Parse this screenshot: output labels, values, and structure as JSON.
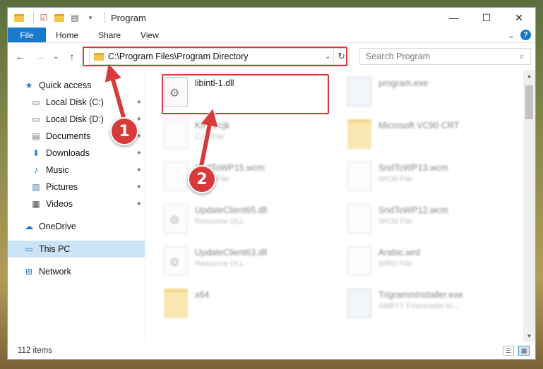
{
  "window": {
    "title": "Program",
    "controls": {
      "minimize": "—",
      "maximize": "☐",
      "close": "✕"
    }
  },
  "ribbon": {
    "tabs": [
      "File",
      "Home",
      "Share",
      "View"
    ],
    "expand": "⌄",
    "help": "?"
  },
  "nav": {
    "back": "←",
    "forward": "→",
    "recent": "⌄",
    "up": "↑"
  },
  "address": {
    "path": "C:\\Program Files\\Program Directory",
    "dropdown": "⌄",
    "refresh": "↻"
  },
  "search": {
    "placeholder": "Search Program",
    "icon": "⌕"
  },
  "sidebar": {
    "items": [
      {
        "label": "Quick access",
        "icon": "star-icon",
        "glyph": "★",
        "color": "#1979ca"
      },
      {
        "label": "Local Disk (C:)",
        "icon": "drive-icon",
        "glyph": "▭",
        "pinned": true
      },
      {
        "label": "Local Disk (D:)",
        "icon": "drive-icon",
        "glyph": "▭",
        "pinned": true
      },
      {
        "label": "Documents",
        "icon": "documents-icon",
        "glyph": "▤",
        "pinned": true
      },
      {
        "label": "Downloads",
        "icon": "downloads-icon",
        "glyph": "⬇",
        "pinned": true,
        "color": "#1979ca"
      },
      {
        "label": "Music",
        "icon": "music-icon",
        "glyph": "♪",
        "pinned": true,
        "color": "#1979ca"
      },
      {
        "label": "Pictures",
        "icon": "pictures-icon",
        "glyph": "▨",
        "pinned": true
      },
      {
        "label": "Videos",
        "icon": "videos-icon",
        "glyph": "▦",
        "pinned": true
      },
      {
        "label": "OneDrive",
        "icon": "cloud-icon",
        "glyph": "☁",
        "color": "#1979ca"
      },
      {
        "label": "This PC",
        "icon": "computer-icon",
        "glyph": "▭",
        "color": "#1979ca",
        "selected": true
      },
      {
        "label": "Network",
        "icon": "network-icon",
        "glyph": "⊞",
        "color": "#1979ca"
      }
    ]
  },
  "files": [
    {
      "name": "libintl-1.dll",
      "sub": "",
      "kind": "dll",
      "highlight": true
    },
    {
      "name": "program.exe",
      "sub": "",
      "kind": "exe",
      "faded": true
    },
    {
      "name": "Kfiles.cjk",
      "sub": "CJK File",
      "kind": "doc",
      "faded": true
    },
    {
      "name": "Microsoft VC90 CRT",
      "sub": "",
      "kind": "folder",
      "faded": true
    },
    {
      "name": "SndToWP15.wcm",
      "sub": "WCM File",
      "kind": "doc",
      "faded": true
    },
    {
      "name": "SndToWP13.wcm",
      "sub": "WCM File",
      "kind": "doc",
      "faded": true
    },
    {
      "name": "UpdateClient65.dll",
      "sub": "Resource DLL",
      "kind": "dll",
      "faded": true
    },
    {
      "name": "SndToWP12.wcm",
      "sub": "WCM File",
      "kind": "doc",
      "faded": true
    },
    {
      "name": "UpdateClient63.dll",
      "sub": "Resource DLL",
      "kind": "dll",
      "faded": true
    },
    {
      "name": "Arabic.wrd",
      "sub": "WRD File",
      "kind": "doc",
      "faded": true
    },
    {
      "name": "x64",
      "sub": "",
      "kind": "folder",
      "faded": true
    },
    {
      "name": "TrigrammInstaller.exe",
      "sub": "ABBYY Finereader tri...",
      "kind": "exe",
      "faded": true
    }
  ],
  "status": {
    "count": "112 items"
  },
  "annotations": {
    "badge1": "1",
    "badge2": "2",
    "accent": "#d63a3a"
  }
}
